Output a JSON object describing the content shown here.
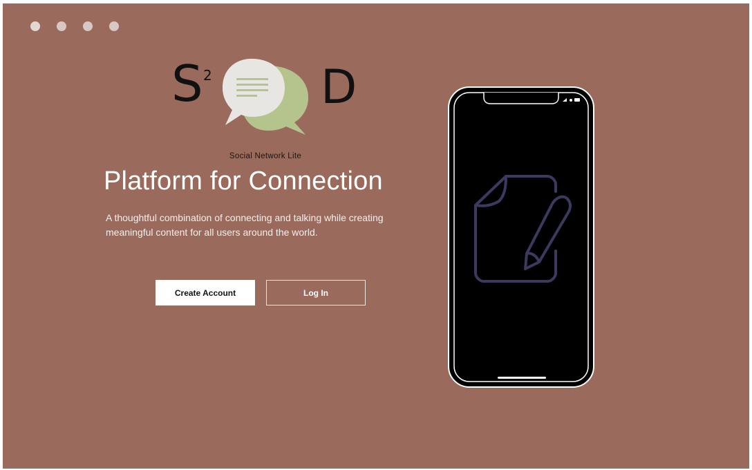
{
  "app": {
    "logo": {
      "letter_left": "S",
      "superscript": "2",
      "letter_right": "D"
    },
    "tagline": "Social Network Lite",
    "headline": "Platform for Connection",
    "description": "A thoughtful combination of connecting and talking while creating meaningful content for all users around the world.",
    "buttons": {
      "create_account": "Create Account",
      "log_in": "Log In"
    }
  },
  "colors": {
    "background": "#9a6b5d",
    "bubble_light": "#e8e6e3",
    "bubble_green": "#b5c48d",
    "phone_screen": "#000000",
    "phone_icon_stroke": "#3b3a5e"
  },
  "icons": {
    "window_dots": [
      "window-dot",
      "window-dot",
      "window-dot",
      "window-dot"
    ],
    "phone_screen_icon": "document-edit-icon",
    "logo_icon": "chat-bubbles-icon"
  }
}
